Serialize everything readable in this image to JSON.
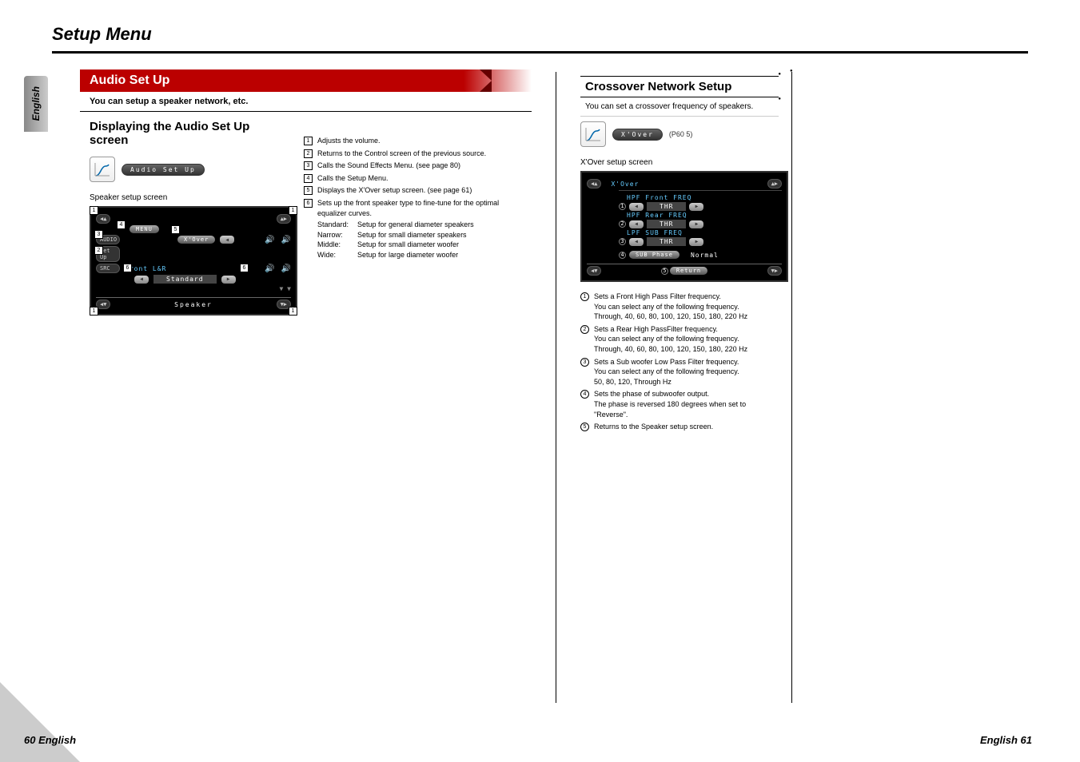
{
  "page_title": "Setup Menu",
  "language_tab": "English",
  "left": {
    "header": "Audio Set Up",
    "subtitle": "You can setup a speaker network, etc.",
    "sub_heading": "Displaying the Audio Set Up screen",
    "pill_audio": "Audio Set Up",
    "speaker_caption": "Speaker setup screen",
    "screen": {
      "menu": "MENU",
      "audio": "AUDIO",
      "setup": "Set Up",
      "src": "SRC",
      "xover": "X'Over",
      "front_lr": "Front L&R",
      "standard": "Standard",
      "footer": "Speaker"
    },
    "desc": [
      {
        "n": "1",
        "text": "Adjusts the volume."
      },
      {
        "n": "2",
        "text": "Returns to the Control screen of the previous source."
      },
      {
        "n": "3",
        "text": "Calls the Sound Effects Menu. (see page 80)"
      },
      {
        "n": "4",
        "text": "Calls the Setup Menu."
      },
      {
        "n": "5",
        "text": "Displays the X'Over setup screen. (see page 61)"
      },
      {
        "n": "6",
        "text": "Sets up the front speaker type to fine-tune for the optimal equalizer curves."
      }
    ],
    "subrows": [
      {
        "k": "Standard:",
        "v": "Setup for general diameter speakers"
      },
      {
        "k": "Narrow:",
        "v": "Setup for small diameter speakers"
      },
      {
        "k": "Middle:",
        "v": "Setup for small diameter woofer"
      },
      {
        "k": "Wide:",
        "v": "Setup for large diameter woofer"
      }
    ]
  },
  "right": {
    "header": "Crossover Network Setup",
    "subtitle": "You can set a crossover frequency of speakers.",
    "pill_xover": "X'Over",
    "ref": "(P60 5)",
    "xover_caption": "X'Over setup screen",
    "screen": {
      "title": "X'Over",
      "hpf_front": "HPF Front FREQ",
      "hpf_rear": "HPF Rear FREQ",
      "lpf_sub": "LPF SUB FREQ",
      "thr": "THR",
      "sub_phase": "SUB Phase",
      "normal": "Normal",
      "return": "Return"
    },
    "desc": [
      {
        "n": "1",
        "text": "Sets a Front High Pass Filter frequency.\nYou can select any of the following frequency.\nThrough, 40, 60, 80, 100, 120, 150, 180, 220 Hz"
      },
      {
        "n": "2",
        "text": "Sets a Rear High PassFilter frequency.\nYou can select any of the following frequency.\nThrough, 40, 60, 80, 100, 120, 150, 180, 220 Hz"
      },
      {
        "n": "3",
        "text": "Sets a Sub woofer Low Pass Filter frequency.\nYou can select any of the following frequency.\n50, 80, 120, Through Hz"
      },
      {
        "n": "4",
        "text": "Sets the phase of subwoofer output.\nThe phase is reversed 180 degrees when set to \"Reverse\"."
      },
      {
        "n": "5",
        "text": "Returns to the Speaker setup screen."
      }
    ]
  },
  "footer_left": "60 English",
  "footer_right": "English 61"
}
